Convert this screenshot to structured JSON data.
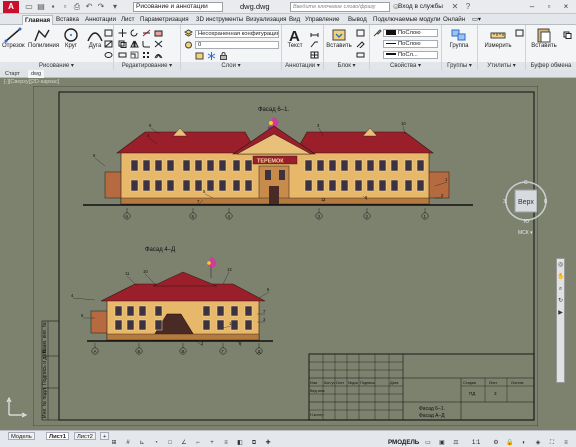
{
  "title_bar": {
    "app_logo": "A",
    "workspace": "Рисование и аннотации",
    "document_title": "dwg.dwg",
    "search_placeholder": "Введите ключевое слово/фразу",
    "signin": "Вход в службы",
    "help": "?"
  },
  "ribbon_tabs": [
    {
      "label": "Главная",
      "active": true
    },
    {
      "label": "Вставка"
    },
    {
      "label": "Аннотации"
    },
    {
      "label": "Лист"
    },
    {
      "label": "Параметризация"
    },
    {
      "label": "3D инструменты"
    },
    {
      "label": "Визуализация"
    },
    {
      "label": "Вид"
    },
    {
      "label": "Управление"
    },
    {
      "label": "Вывод"
    },
    {
      "label": "Подключаемые модули"
    },
    {
      "label": "Онлайн"
    }
  ],
  "ribbon": {
    "draw": {
      "title": "Рисование ▾",
      "tools": [
        "Отрезок",
        "Полилиния",
        "Круг",
        "Дуга"
      ]
    },
    "modify": {
      "title": "Редактирование ▾"
    },
    "layers": {
      "title": "Слои ▾",
      "layer_state": "Несохраненная конфигурация сло ▾",
      "current_layer": "0"
    },
    "annotation": {
      "title": "Аннотации ▾",
      "tool": "Текст"
    },
    "block": {
      "title": "Блок ▾",
      "tool": "Вставить"
    },
    "properties": {
      "title": "Свойства ▾",
      "color": "ПоСлою",
      "linetype": "ПоСлою",
      "lineweight": "ПоСл..."
    },
    "groups": {
      "title": "Группы ▾",
      "tool": "Группа"
    },
    "utilities": {
      "title": "Утилиты ▾",
      "tool": "Измерить"
    },
    "clipboard": {
      "title": "Буфер обмена",
      "tool": "Вставить"
    }
  },
  "file_tabs": [
    "Старт",
    "dwg"
  ],
  "viewport_label": "[-][Сверху][2D-каркас]",
  "viewcube": {
    "face": "Верх",
    "n": "С",
    "s": "Ю",
    "w": "З",
    "e": "В",
    "ucs": "МСК ▾"
  },
  "drawing": {
    "facade1_title": "Фасад 6–1.",
    "facade2_title": "Фасад 4–Д",
    "sign_text": "ТЕРЕМОК",
    "axes_facade1": [
      "6",
      "5",
      "4",
      "3",
      "2",
      "1"
    ],
    "axes_facade2": [
      "А",
      "Б",
      "В",
      "Г",
      "Д"
    ],
    "callouts_facade1": [
      "1",
      "2",
      "3",
      "4",
      "5",
      "6",
      "7",
      "8",
      "9",
      "10",
      "11"
    ],
    "callouts_facade2": [
      "1",
      "2",
      "3",
      "4",
      "6",
      "7",
      "8",
      "9",
      "10",
      "11",
      "12"
    ],
    "stamp_headers": [
      "Изм",
      "Кол.уч",
      "Лист",
      "№док",
      "Подпись",
      "Дата"
    ],
    "stamp_rows": [
      "Вед.инж",
      "Н.контр"
    ],
    "stamp_stage_headers": [
      "Стадия",
      "Лист",
      "Листов"
    ],
    "stamp_stage_values": [
      "ПД",
      "3",
      ""
    ],
    "stamp_sheet_name_1": "Фасад 6–1.",
    "stamp_sheet_name_2": "Фасад А–Д",
    "left_strip": [
      "Инв. № подл.",
      "Подпись и дата",
      "Взам. инв. №"
    ]
  },
  "status_bar": {
    "layout_tabs": [
      {
        "label": "Модель"
      },
      {
        "label": "Лист1",
        "active": true
      },
      {
        "label": "Лист2"
      }
    ],
    "add_tab": "+",
    "space": "РМОДЕЛЬ",
    "scale": "1:1"
  },
  "colors": {
    "canvas": "#7d826f",
    "roof": "#9a1f2a",
    "wall": "#e7b86a",
    "window": "#3d3240",
    "ribbon": "#f4f5f7",
    "accent": "#c8102e"
  }
}
